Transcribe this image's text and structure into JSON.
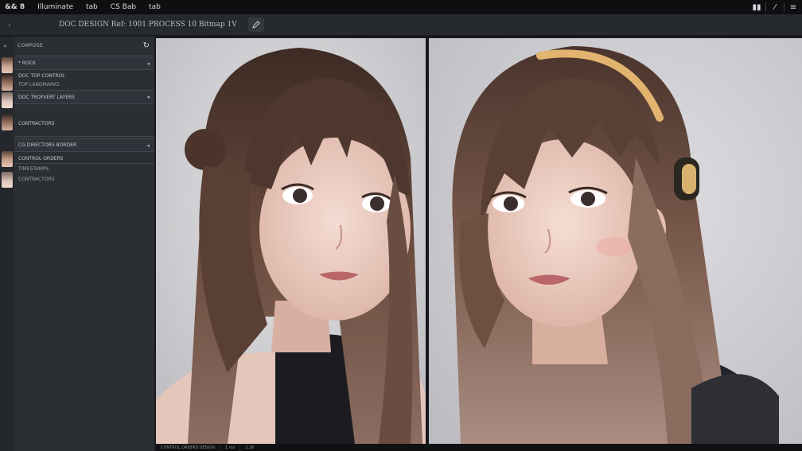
{
  "menubar": {
    "items": [
      "&& 8",
      "Illuminate",
      "tab",
      "CS  Bab",
      "tab"
    ]
  },
  "docbar": {
    "title": "DOC DESIGN Ref: 1001 PROCESS 10 Bitmap 1V"
  },
  "panel": {
    "header": "COMPOSE",
    "refresh_icon": "↻"
  },
  "layers": [
    {
      "label": "* ROCK",
      "sub": "",
      "marker": "◂"
    },
    {
      "label": "DOC TOP CONTROL",
      "sub": "",
      "marker": ""
    },
    {
      "label": "TOP LANDMARKS",
      "sub": "",
      "marker": ""
    },
    {
      "label": "DOC TROYVERT LAYERS",
      "sub": "",
      "marker": "◂"
    },
    {
      "label": "CONTRACTORS",
      "sub": "",
      "marker": ""
    },
    {
      "label": "CG DIRECTORS  BORDER",
      "sub": "",
      "marker": "◂"
    },
    {
      "label": "CONTROL ORDERS",
      "sub": "",
      "marker": ""
    },
    {
      "label": "TIMESTAMPS",
      "sub": "",
      "marker": ""
    },
    {
      "label": "CONTRACTORS",
      "sub": "",
      "marker": ""
    }
  ],
  "status": {
    "left": "CONTROL ORDERS DESIGN",
    "mid": "1 ms",
    "right": "2.26"
  },
  "colors": {
    "menubar": "#0e0f11",
    "sidebar": "#2b2e33",
    "canvas_bg": "#d9d8dc",
    "hair": "#5a4034",
    "headband": "#e2b46f"
  }
}
